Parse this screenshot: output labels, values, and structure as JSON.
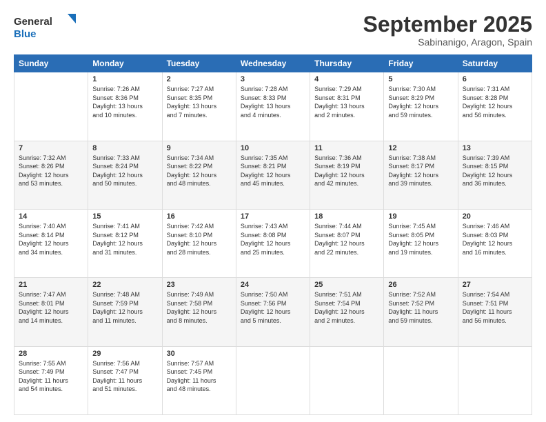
{
  "logo": {
    "line1": "General",
    "line2": "Blue"
  },
  "title": "September 2025",
  "subtitle": "Sabinanigo, Aragon, Spain",
  "days_of_week": [
    "Sunday",
    "Monday",
    "Tuesday",
    "Wednesday",
    "Thursday",
    "Friday",
    "Saturday"
  ],
  "weeks": [
    [
      {
        "day": "",
        "info": ""
      },
      {
        "day": "1",
        "info": "Sunrise: 7:26 AM\nSunset: 8:36 PM\nDaylight: 13 hours\nand 10 minutes."
      },
      {
        "day": "2",
        "info": "Sunrise: 7:27 AM\nSunset: 8:35 PM\nDaylight: 13 hours\nand 7 minutes."
      },
      {
        "day": "3",
        "info": "Sunrise: 7:28 AM\nSunset: 8:33 PM\nDaylight: 13 hours\nand 4 minutes."
      },
      {
        "day": "4",
        "info": "Sunrise: 7:29 AM\nSunset: 8:31 PM\nDaylight: 13 hours\nand 2 minutes."
      },
      {
        "day": "5",
        "info": "Sunrise: 7:30 AM\nSunset: 8:29 PM\nDaylight: 12 hours\nand 59 minutes."
      },
      {
        "day": "6",
        "info": "Sunrise: 7:31 AM\nSunset: 8:28 PM\nDaylight: 12 hours\nand 56 minutes."
      }
    ],
    [
      {
        "day": "7",
        "info": "Sunrise: 7:32 AM\nSunset: 8:26 PM\nDaylight: 12 hours\nand 53 minutes."
      },
      {
        "day": "8",
        "info": "Sunrise: 7:33 AM\nSunset: 8:24 PM\nDaylight: 12 hours\nand 50 minutes."
      },
      {
        "day": "9",
        "info": "Sunrise: 7:34 AM\nSunset: 8:22 PM\nDaylight: 12 hours\nand 48 minutes."
      },
      {
        "day": "10",
        "info": "Sunrise: 7:35 AM\nSunset: 8:21 PM\nDaylight: 12 hours\nand 45 minutes."
      },
      {
        "day": "11",
        "info": "Sunrise: 7:36 AM\nSunset: 8:19 PM\nDaylight: 12 hours\nand 42 minutes."
      },
      {
        "day": "12",
        "info": "Sunrise: 7:38 AM\nSunset: 8:17 PM\nDaylight: 12 hours\nand 39 minutes."
      },
      {
        "day": "13",
        "info": "Sunrise: 7:39 AM\nSunset: 8:15 PM\nDaylight: 12 hours\nand 36 minutes."
      }
    ],
    [
      {
        "day": "14",
        "info": "Sunrise: 7:40 AM\nSunset: 8:14 PM\nDaylight: 12 hours\nand 34 minutes."
      },
      {
        "day": "15",
        "info": "Sunrise: 7:41 AM\nSunset: 8:12 PM\nDaylight: 12 hours\nand 31 minutes."
      },
      {
        "day": "16",
        "info": "Sunrise: 7:42 AM\nSunset: 8:10 PM\nDaylight: 12 hours\nand 28 minutes."
      },
      {
        "day": "17",
        "info": "Sunrise: 7:43 AM\nSunset: 8:08 PM\nDaylight: 12 hours\nand 25 minutes."
      },
      {
        "day": "18",
        "info": "Sunrise: 7:44 AM\nSunset: 8:07 PM\nDaylight: 12 hours\nand 22 minutes."
      },
      {
        "day": "19",
        "info": "Sunrise: 7:45 AM\nSunset: 8:05 PM\nDaylight: 12 hours\nand 19 minutes."
      },
      {
        "day": "20",
        "info": "Sunrise: 7:46 AM\nSunset: 8:03 PM\nDaylight: 12 hours\nand 16 minutes."
      }
    ],
    [
      {
        "day": "21",
        "info": "Sunrise: 7:47 AM\nSunset: 8:01 PM\nDaylight: 12 hours\nand 14 minutes."
      },
      {
        "day": "22",
        "info": "Sunrise: 7:48 AM\nSunset: 7:59 PM\nDaylight: 12 hours\nand 11 minutes."
      },
      {
        "day": "23",
        "info": "Sunrise: 7:49 AM\nSunset: 7:58 PM\nDaylight: 12 hours\nand 8 minutes."
      },
      {
        "day": "24",
        "info": "Sunrise: 7:50 AM\nSunset: 7:56 PM\nDaylight: 12 hours\nand 5 minutes."
      },
      {
        "day": "25",
        "info": "Sunrise: 7:51 AM\nSunset: 7:54 PM\nDaylight: 12 hours\nand 2 minutes."
      },
      {
        "day": "26",
        "info": "Sunrise: 7:52 AM\nSunset: 7:52 PM\nDaylight: 11 hours\nand 59 minutes."
      },
      {
        "day": "27",
        "info": "Sunrise: 7:54 AM\nSunset: 7:51 PM\nDaylight: 11 hours\nand 56 minutes."
      }
    ],
    [
      {
        "day": "28",
        "info": "Sunrise: 7:55 AM\nSunset: 7:49 PM\nDaylight: 11 hours\nand 54 minutes."
      },
      {
        "day": "29",
        "info": "Sunrise: 7:56 AM\nSunset: 7:47 PM\nDaylight: 11 hours\nand 51 minutes."
      },
      {
        "day": "30",
        "info": "Sunrise: 7:57 AM\nSunset: 7:45 PM\nDaylight: 11 hours\nand 48 minutes."
      },
      {
        "day": "",
        "info": ""
      },
      {
        "day": "",
        "info": ""
      },
      {
        "day": "",
        "info": ""
      },
      {
        "day": "",
        "info": ""
      }
    ]
  ]
}
